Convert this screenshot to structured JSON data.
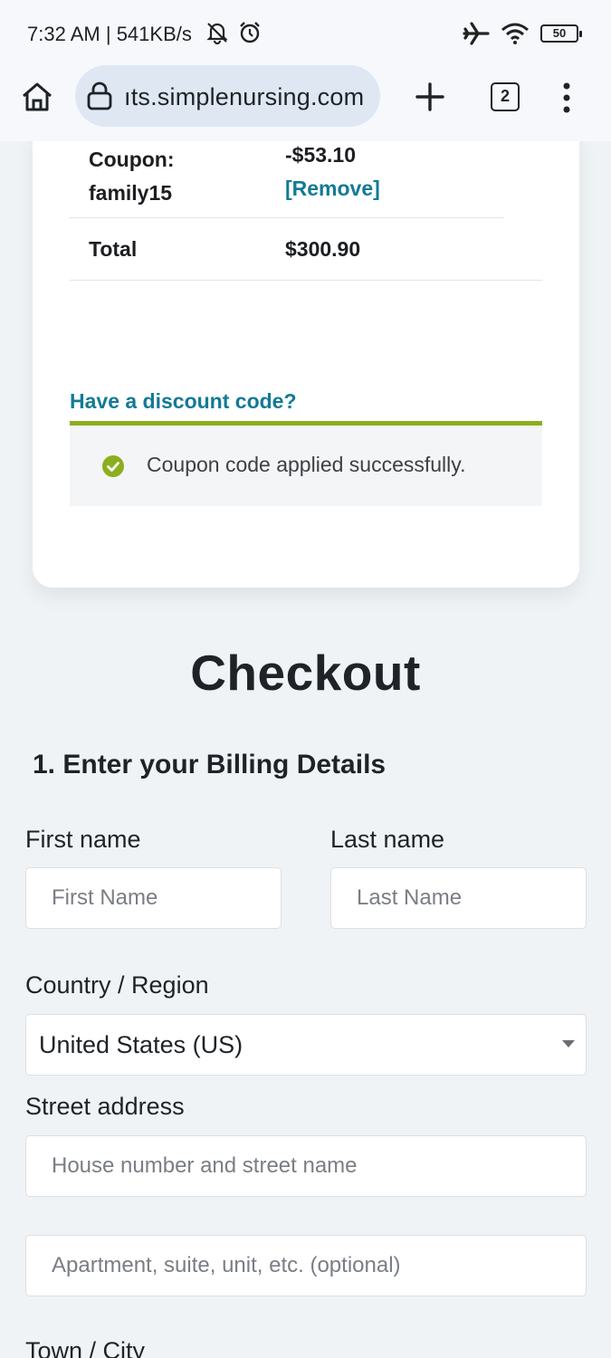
{
  "status_bar": {
    "time": "7:32 AM",
    "separator": "|",
    "speed": "541KB/s",
    "battery": "50",
    "icons": [
      "mute-bell-icon",
      "alarm-icon",
      "airplane-icon",
      "wifi-icon",
      "battery-icon"
    ]
  },
  "browser": {
    "url": "ıts.simplenursing.com",
    "tab_count": "2",
    "icons": [
      "home-icon",
      "lock-icon",
      "plus-icon",
      "tabs-icon",
      "menu-icon"
    ]
  },
  "order_summary": {
    "coupon_label": "Coupon:",
    "coupon_code": "family15",
    "coupon_amount": "-$53.10",
    "remove_label": "[Remove]",
    "total_label": "Total",
    "total_value": "$300.90"
  },
  "discount": {
    "link_text": "Have a discount code?",
    "success_message": "Coupon code applied successfully.",
    "accent_color": "#8cae1e"
  },
  "checkout": {
    "title": "Checkout",
    "section_title": "1. Enter your Billing Details",
    "first_name_label": "First name",
    "first_name_placeholder": "First Name",
    "last_name_label": "Last name",
    "last_name_placeholder": "Last Name",
    "country_label": "Country / Region",
    "country_value": "United States (US)",
    "street_label": "Street address",
    "street_placeholder": "House number and street name",
    "apartment_placeholder": "Apartment, suite, unit, etc. (optional)",
    "town_label": "Town / City"
  },
  "colors": {
    "link": "#127a96",
    "success": "#8cae1e",
    "page_bg": "#f0f3f5"
  }
}
